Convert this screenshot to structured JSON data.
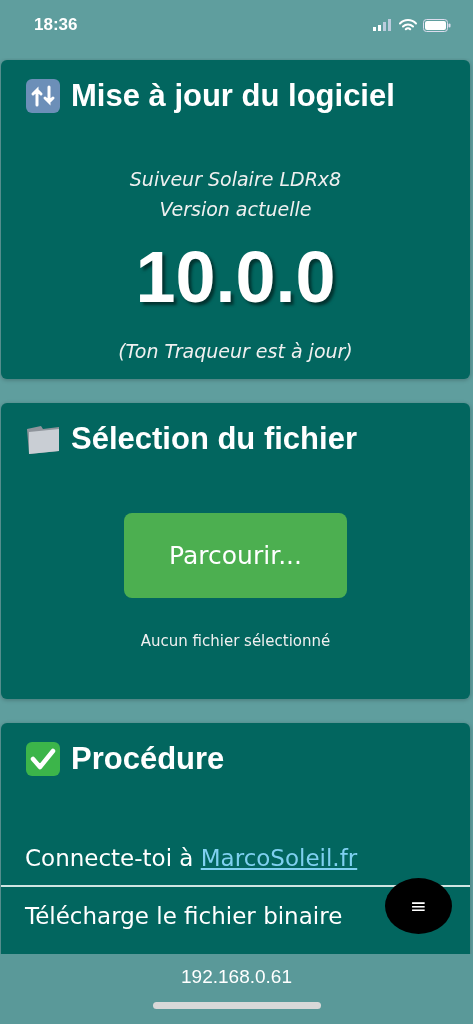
{
  "status_bar": {
    "time": "18:36"
  },
  "update_card": {
    "title": "Mise à jour du logiciel",
    "product": "Suiveur Solaire LDRx8",
    "version_label": "Version actuelle",
    "version": "10.0.0",
    "status": "(Ton Traqueur est à jour)"
  },
  "file_card": {
    "title": "Sélection du fichier",
    "button": "Parcourir...",
    "file_status": "Aucun fichier sélectionné"
  },
  "procedure_card": {
    "title": "Procédure",
    "steps": [
      {
        "text": "Connecte-toi à ",
        "link": "MarcoSoleil.fr"
      },
      {
        "text": "Télécharge le fichier binaire"
      }
    ]
  },
  "menu_button": "≡",
  "address_bar": {
    "url": "192.168.0.61"
  }
}
